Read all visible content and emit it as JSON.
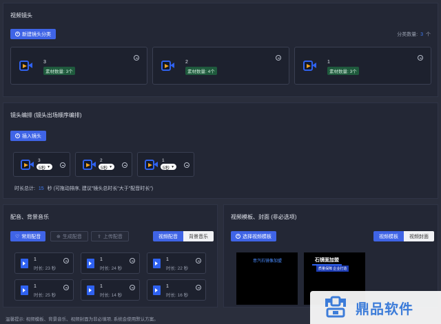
{
  "shots": {
    "title": "视频镜头",
    "new_btn": "新建镜头分类",
    "count_label": "分类数量:",
    "count_value": "3",
    "count_unit": "个",
    "cards": [
      {
        "num": "3",
        "badge": "素材数量: 3个"
      },
      {
        "num": "2",
        "badge": "素材数量: 4个"
      },
      {
        "num": "1",
        "badge": "素材数量: 3个"
      }
    ]
  },
  "arrange": {
    "title": "镜头编排 (镜头出场顺序编排)",
    "insert_btn": "插入镜头",
    "items": [
      {
        "num": "3",
        "dur": "5秒"
      },
      {
        "num": "2",
        "dur": "5秒"
      },
      {
        "num": "1",
        "dur": "5秒"
      }
    ],
    "total_prefix": "时长总计:",
    "total_value": "15",
    "total_suffix": "秒 (可拖动排序, 建议\"镜头总时长\"大于\"配音时长\")"
  },
  "audio": {
    "title": "配音、背景音乐",
    "btn_common": "常用配音",
    "btn_generate": "生成配音",
    "btn_upload": "上传配音",
    "tab_voice": "视频配音",
    "tab_bgm": "背景音乐",
    "items": [
      {
        "num": "1",
        "dur": "时长: 23 秒"
      },
      {
        "num": "1",
        "dur": "时长: 24 秒"
      },
      {
        "num": "1",
        "dur": "时长: 22 秒"
      },
      {
        "num": "1",
        "dur": "时长: 25 秒"
      },
      {
        "num": "1",
        "dur": "时长: 14 秒"
      },
      {
        "num": "1",
        "dur": "时长: 16 秒"
      }
    ]
  },
  "template": {
    "title": "视频模板、封面 (非必选项)",
    "select_btn": "选择视频模板",
    "tab_template": "视频模板",
    "tab_cover": "视频封面",
    "thumb1_text": "意汽石镜像加盟",
    "thumb2_title": "石镜面加盟",
    "thumb2_sub": "质量保障 企业打造"
  },
  "footer": {
    "tip": "温馨提示: 视频模板、背景音乐、视频封面为非必填项, 系统会使用默认方案。"
  },
  "watermark": {
    "text": "鼎品软件"
  },
  "colors": {
    "accent": "#3f64e6",
    "badge_bg": "#1f5a3d",
    "camera_play": "#f5a623"
  }
}
